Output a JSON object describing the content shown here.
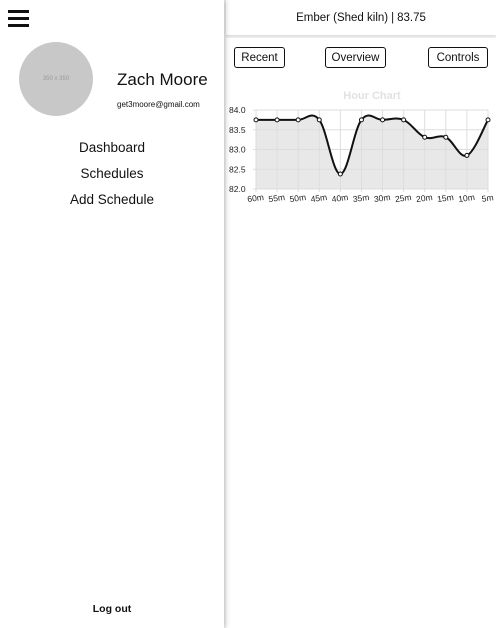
{
  "sidebar": {
    "avatar_placeholder": "350 x 350",
    "user": {
      "name": "Zach Moore",
      "email": "get3moore@gmail.com"
    },
    "nav": [
      {
        "label": "Dashboard"
      },
      {
        "label": "Schedules"
      },
      {
        "label": "Add Schedule"
      }
    ],
    "logout_label": "Log out",
    "menu_icon": "hamburger-menu-icon"
  },
  "header": {
    "device_name": "Ember (Shed kiln)",
    "separator": "|",
    "temperature": "83.75"
  },
  "buttons": {
    "recent": "Recent",
    "overview": "Overview",
    "controls": "Controls"
  },
  "chart_data": {
    "type": "line",
    "title": "Hour Chart",
    "xlabel": "",
    "ylabel": "",
    "categories": [
      "60m",
      "55m",
      "50m",
      "45m",
      "40m",
      "35m",
      "30m",
      "25m",
      "20m",
      "15m",
      "10m",
      "5m"
    ],
    "values": [
      83.75,
      83.75,
      83.75,
      83.75,
      82.38,
      83.75,
      83.75,
      83.75,
      83.31,
      83.31,
      82.85,
      83.75
    ],
    "ylim": [
      82.0,
      84.0
    ],
    "yticks": [
      "84.0",
      "83.5",
      "83.0",
      "82.5",
      "82.0"
    ],
    "grid": true,
    "fill": true,
    "colors": {
      "line": "#111111",
      "fill": "#e8e8e8",
      "grid": "#dddddd",
      "title": "#e2e2e2"
    }
  }
}
